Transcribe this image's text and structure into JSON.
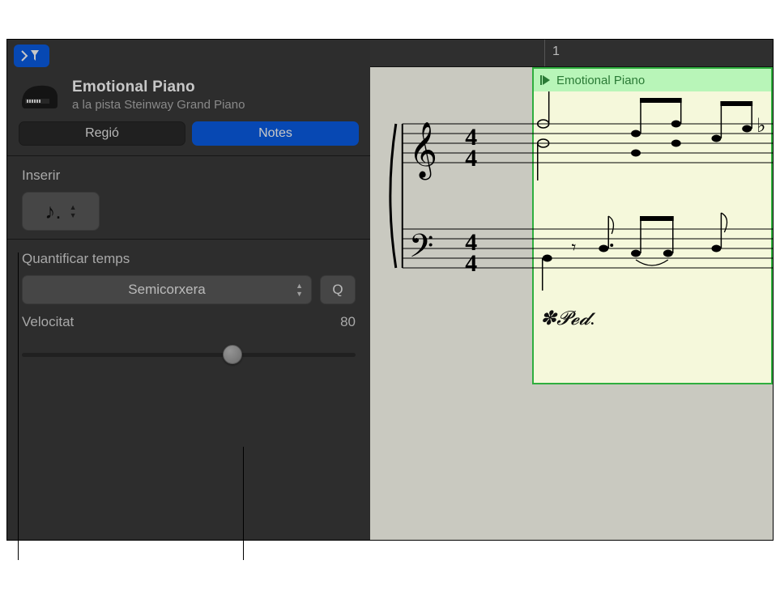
{
  "header": {
    "title": "Emotional Piano",
    "subtitle": "a la pista Steinway Grand Piano"
  },
  "tabs": {
    "region": "Regió",
    "notes": "Notes"
  },
  "insert": {
    "label": "Inserir",
    "note_icon": "dotted-eighth-note"
  },
  "quantize": {
    "label": "Quantificar temps",
    "value": "Semicorxera",
    "q_button": "Q"
  },
  "velocity": {
    "label": "Velocitat",
    "value": "80",
    "percent": 63
  },
  "ruler": {
    "bar1": "1"
  },
  "region": {
    "name": "Emotional Piano",
    "pedal": "✽𝓟𝓮𝓭."
  },
  "icons": {
    "filter": "filter-icon",
    "piano": "grand-piano-icon",
    "play_region": "play-region-icon"
  },
  "colors": {
    "accent": "#0a5de6",
    "region_green": "#2fae3e",
    "region_fill": "#f5f8db"
  }
}
